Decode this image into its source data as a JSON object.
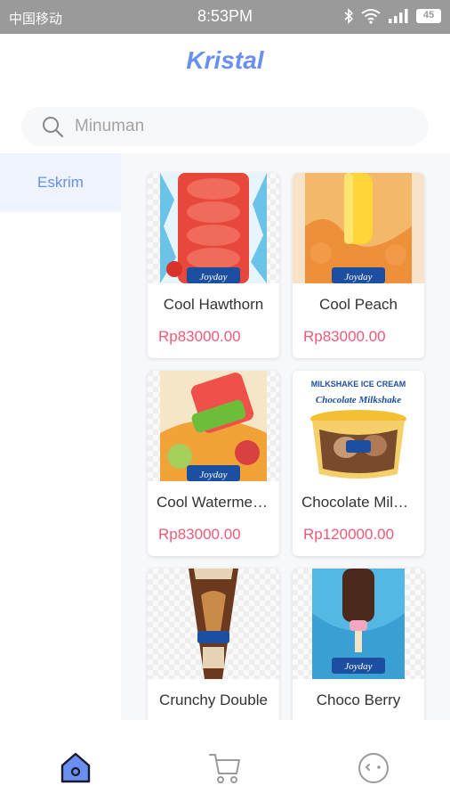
{
  "status_bar": {
    "carrier": "中国移动",
    "time": "8:53PM",
    "battery": "45"
  },
  "app": {
    "title": "Kristal"
  },
  "search": {
    "placeholder": "Minuman"
  },
  "sidebar": {
    "items": [
      {
        "label": "Eskrim",
        "active": true
      }
    ]
  },
  "products": [
    {
      "name": "Cool Hawthorn",
      "price": "Rp83000.00",
      "image": "red-popsicle"
    },
    {
      "name": "Cool Peach",
      "price": "Rp83000.00",
      "image": "yellow-popsicle"
    },
    {
      "name": "Cool Watermelon",
      "price": "Rp83000.00",
      "image": "watermelon-popsicle"
    },
    {
      "name": "Chocolate Milkshake",
      "price": "Rp120000.00",
      "image": "ice-cream-tub"
    },
    {
      "name": "Crunchy Double",
      "price": "",
      "image": "cone"
    },
    {
      "name": "Choco Berry",
      "price": "",
      "image": "choco-stick"
    }
  ],
  "package_texts": {
    "brand": "Joyday",
    "tub_line1": "MILKSHAKE ICE CREAM",
    "tub_line2": "Chocolate Milkshake"
  },
  "tabs": [
    {
      "icon": "home-icon",
      "active": true
    },
    {
      "icon": "cart-icon",
      "active": false
    },
    {
      "icon": "profile-icon",
      "active": false
    }
  ],
  "colors": {
    "accent": "#6a8ff0",
    "price": "#ee5a7a",
    "status_bar": "#9a9a9a"
  }
}
